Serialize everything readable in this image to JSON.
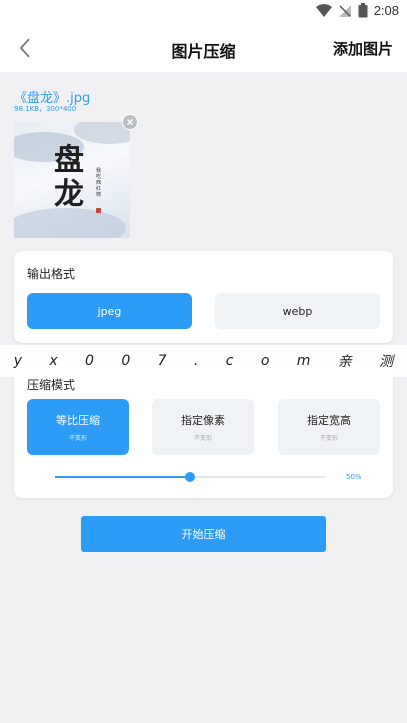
{
  "status_bar": {
    "time": "2:08"
  },
  "app_bar": {
    "title": "图片压缩",
    "action_label": "添加图片"
  },
  "file": {
    "name": "《盘龙》.jpg",
    "meta": "98.1KB，300*400"
  },
  "thumbnail": {
    "cover_title": "盘龙",
    "cover_author": "我吃西红柿"
  },
  "output_format": {
    "title": "输出格式",
    "options": [
      "jpeg",
      "webp"
    ],
    "selected": "jpeg"
  },
  "compress_mode": {
    "title": "压缩模式",
    "modes": [
      {
        "label": "等比压缩",
        "sub": "不变形"
      },
      {
        "label": "指定像素",
        "sub": "不变形"
      },
      {
        "label": "指定宽高",
        "sub": "不变形"
      }
    ],
    "selected": "等比压缩",
    "quality_label": "50%",
    "quality_fraction": 0.5
  },
  "watermark": {
    "chars": [
      "y",
      "x",
      "0",
      "0",
      "7",
      ".",
      "c",
      "o",
      "m",
      "亲",
      "测"
    ]
  },
  "start_label": "开始压缩",
  "colors": {
    "accent": "#2d9cf6",
    "background": "#f1f1f3"
  }
}
